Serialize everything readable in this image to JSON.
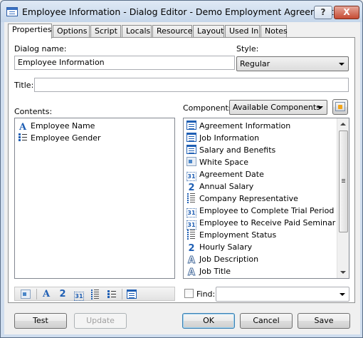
{
  "window": {
    "title": "Employee Information - Dialog Editor - Demo Employment Agreement.cmp",
    "help_label": "?",
    "close_label": "X"
  },
  "tabs": [
    {
      "label": "Properties",
      "active": true
    },
    {
      "label": "Options"
    },
    {
      "label": "Script"
    },
    {
      "label": "Locals"
    },
    {
      "label": "Resource"
    },
    {
      "label": "Layout"
    },
    {
      "label": "Used In"
    },
    {
      "label": "Notes"
    }
  ],
  "form": {
    "dialog_name_label": "Dialog name:",
    "dialog_name_value": "Employee Information",
    "style_label": "Style:",
    "style_value": "Regular",
    "title_label": "Title:",
    "title_value": "",
    "contents_label": "Contents:",
    "components_label": "Components:",
    "components_filter_value": "Available Components"
  },
  "contents": [
    {
      "label": "Employee Name",
      "icon": "text-field-icon"
    },
    {
      "label": "Employee Gender",
      "icon": "list-field-icon"
    }
  ],
  "components": [
    {
      "label": "Agreement Information",
      "icon": "dialog-icon"
    },
    {
      "label": "Job Information",
      "icon": "dialog-icon"
    },
    {
      "label": "Salary and Benefits",
      "icon": "dialog-icon"
    },
    {
      "label": "White Space",
      "icon": "white-space-icon"
    },
    {
      "label": "Agreement Date",
      "icon": "date-field-icon"
    },
    {
      "label": "Annual Salary",
      "icon": "number-field-icon"
    },
    {
      "label": "Company Representative",
      "icon": "dotted-list-icon"
    },
    {
      "label": "Employee to Complete Trial Period",
      "icon": "date-field-icon"
    },
    {
      "label": "Employee to Receive Paid Seminar D...",
      "icon": "date-field-icon"
    },
    {
      "label": "Employment Status",
      "icon": "dotted-list-icon"
    },
    {
      "label": "Hourly Salary",
      "icon": "number-field-icon"
    },
    {
      "label": "Job Description",
      "icon": "text-outline-icon"
    },
    {
      "label": "Job Title",
      "icon": "text-outline-icon"
    }
  ],
  "toolbar_icons": [
    "white-space-icon",
    "text-field-icon",
    "number-field-icon",
    "date-field-icon",
    "true-false-icon",
    "multiple-choice-icon",
    "dialog-icon"
  ],
  "find": {
    "label": "Find:",
    "value": ""
  },
  "buttons": {
    "test": "Test",
    "update": "Update",
    "ok": "OK",
    "cancel": "Cancel",
    "save": "Save"
  },
  "colors": {
    "accent": "#1f5fb4",
    "close": "#c64b33"
  }
}
